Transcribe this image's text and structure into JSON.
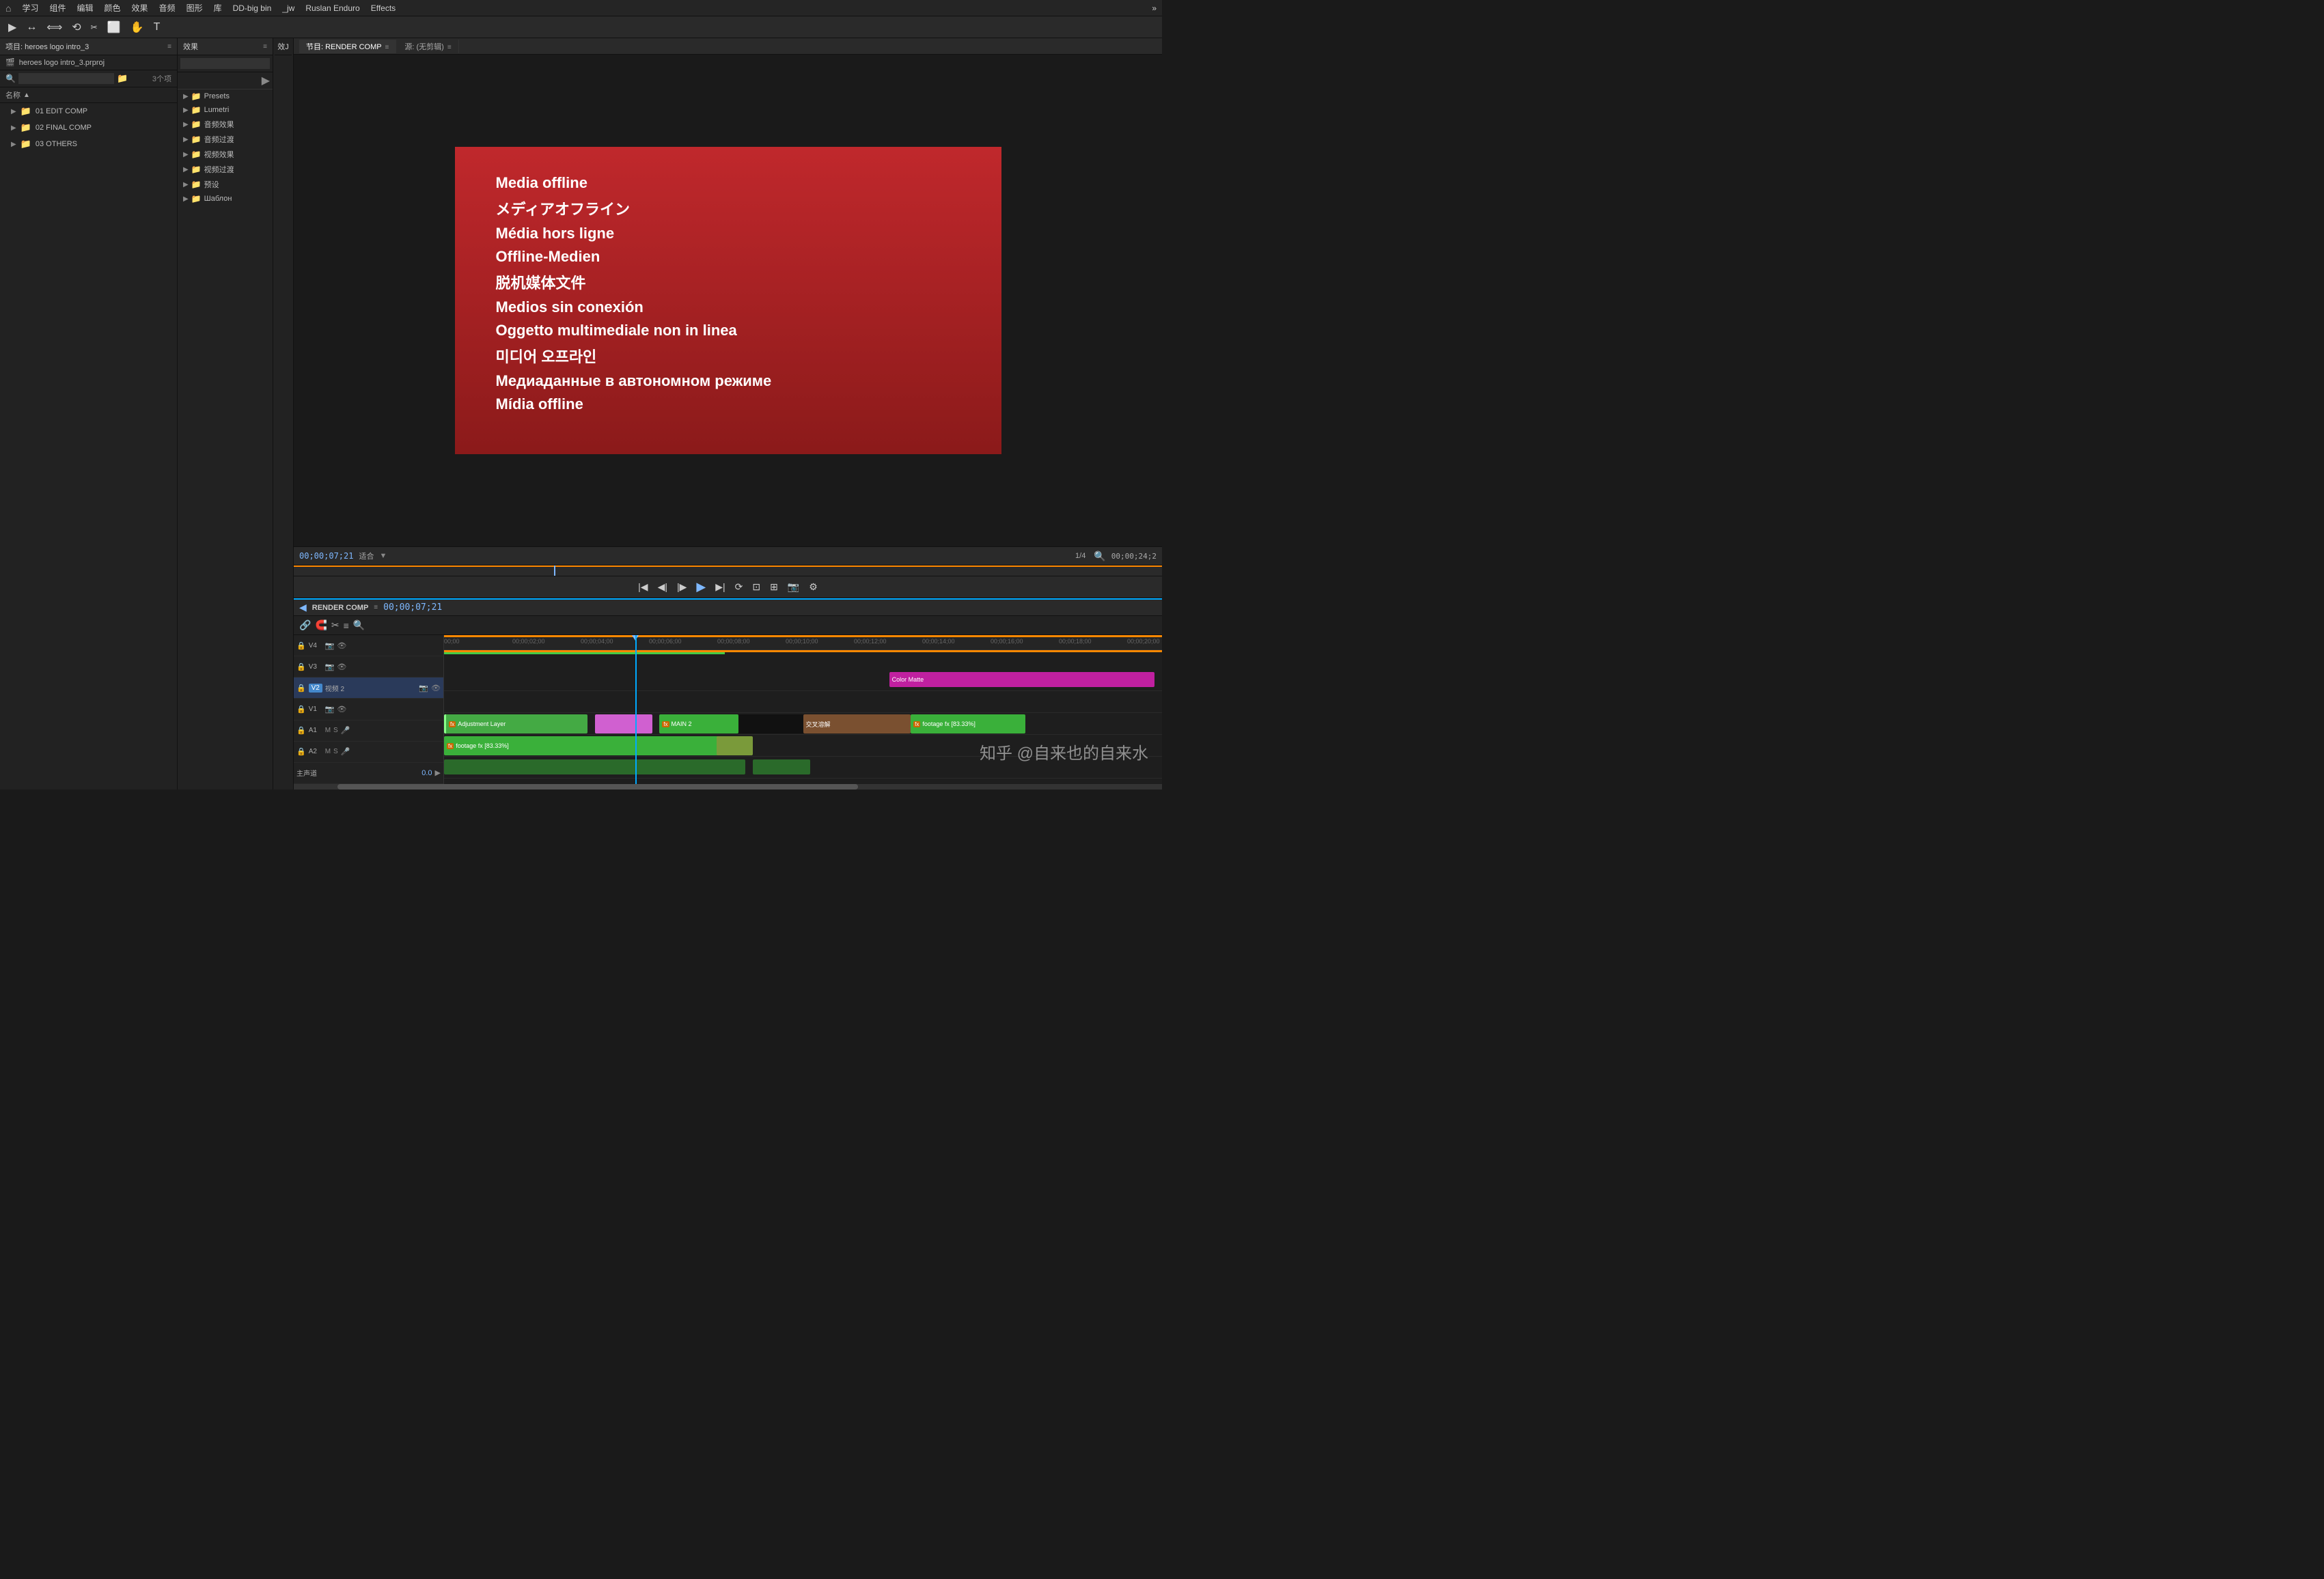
{
  "menu": {
    "home_icon": "⌂",
    "items": [
      "学习",
      "组件",
      "编辑",
      "颜色",
      "效果",
      "音频",
      "图形",
      "库",
      "DD-big bin",
      "_jw",
      "Ruslan Enduro",
      "Effects"
    ],
    "more": "»"
  },
  "toolbar": {
    "tools": [
      "▶",
      "↔",
      "⟺",
      "⟲",
      "⬜",
      "✋",
      "T"
    ]
  },
  "left_panel": {
    "title": "项目: heroes logo intro_3",
    "menu_icon": "≡",
    "file": "heroes logo intro_3.prproj",
    "search_placeholder": "",
    "count": "3个项",
    "col_name": "名称",
    "folders": [
      {
        "name": "01 EDIT COMP",
        "indent": 1
      },
      {
        "name": "02 FINAL COMP",
        "indent": 1
      },
      {
        "name": "03 OTHERS",
        "indent": 1
      }
    ]
  },
  "effects_panel": {
    "title": "效果",
    "menu_icon": "≡",
    "search_placeholder": "",
    "items": [
      {
        "label": "Presets",
        "expanded": false
      },
      {
        "label": "Lumetri ",
        "expanded": false
      },
      {
        "label": "音频效果",
        "expanded": false
      },
      {
        "label": "音频过渡",
        "expanded": false
      },
      {
        "label": "视频效果",
        "expanded": false
      },
      {
        "label": "视频过渡",
        "expanded": false
      },
      {
        "label": "预设",
        "expanded": false
      },
      {
        "label": "Шаблон",
        "expanded": false
      }
    ]
  },
  "xj_panel": {
    "title": "效J"
  },
  "node_tabs": {
    "tabs": [
      "节目: RENDER COMP",
      "源: (无剪辑)"
    ],
    "active": 0
  },
  "preview": {
    "text_lines": [
      "Media offline",
      "メディアオフライン",
      "Média hors ligne",
      "Offline-Medien",
      "脱机媒体文件",
      "Medios sin conexión",
      "Oggetto multimediale non in linea",
      "미디어 오프라인",
      "Медиаданные в автономном режиме",
      "Mídia offline"
    ]
  },
  "preview_controls": {
    "timecode": "00;00;07;21",
    "fit_label": "适合",
    "quality_label": "1/4",
    "timecode_right": "00;00;24;2"
  },
  "playback_controls": {
    "buttons": [
      "◀◀",
      "◀",
      "▶",
      "▶",
      "▶▶",
      "⏮",
      "⏭",
      "⏺"
    ]
  },
  "timeline_section": {
    "comp_name": "RENDER COMP",
    "timecode": "00;00;07;21",
    "tools": [
      "↕",
      "⟲",
      "✂",
      "≡",
      "🔍"
    ],
    "ruler_marks": [
      "00;00",
      "00;00;02;00",
      "00;00;04;00",
      "00;00;06;00",
      "00;00;08;00",
      "00;00;10;00",
      "00;00;12;00",
      "00;00;14;00",
      "00;00;16;00",
      "00;00;18;00",
      "00;00;20;00",
      "00;00"
    ],
    "tracks": [
      {
        "id": "V4",
        "name": "V4",
        "type": "video"
      },
      {
        "id": "V3",
        "name": "V3",
        "type": "video"
      },
      {
        "id": "V2",
        "name": "视频 2",
        "type": "video",
        "highlight": true
      },
      {
        "id": "V1",
        "name": "V1",
        "type": "video"
      },
      {
        "id": "A1",
        "name": "A1",
        "type": "audio"
      },
      {
        "id": "A2",
        "name": "A2",
        "type": "audio"
      },
      {
        "id": "master",
        "name": "主声道",
        "type": "audio"
      }
    ],
    "clips": {
      "v4": [
        {
          "label": "Color Matte",
          "color": "magenta",
          "left_pct": 62,
          "width_pct": 38
        }
      ],
      "v2": [
        {
          "label": "Adjustment Layer",
          "color": "green",
          "left_pct": 0,
          "width_pct": 22
        },
        {
          "label": "",
          "color": "pink",
          "left_pct": 22,
          "width_pct": 8
        },
        {
          "label": "fx MAIN 2",
          "color": "green",
          "left_pct": 33,
          "width_pct": 12
        },
        {
          "label": "",
          "color": "black",
          "left_pct": 45,
          "width_pct": 20
        },
        {
          "label": "交叉溶解",
          "color": "brown",
          "left_pct": 55,
          "width_pct": 14
        },
        {
          "label": "footage fx [83.33%]",
          "color": "green",
          "left_pct": 66,
          "width_pct": 17
        }
      ],
      "v1": [
        {
          "label": "fx footage fx [83.33%]",
          "color": "green",
          "left_pct": 0,
          "width_pct": 42
        },
        {
          "label": "",
          "color": "olive",
          "left_pct": 40,
          "width_pct": 6
        }
      ],
      "a1": [
        {
          "label": "",
          "color": "green-dark",
          "left_pct": 0,
          "width_pct": 45
        },
        {
          "label": "",
          "color": "green-dark",
          "left_pct": 46,
          "width_pct": 8
        }
      ]
    },
    "playhead_pct": 44,
    "watermark": "知乎 @自来也的自来水"
  }
}
